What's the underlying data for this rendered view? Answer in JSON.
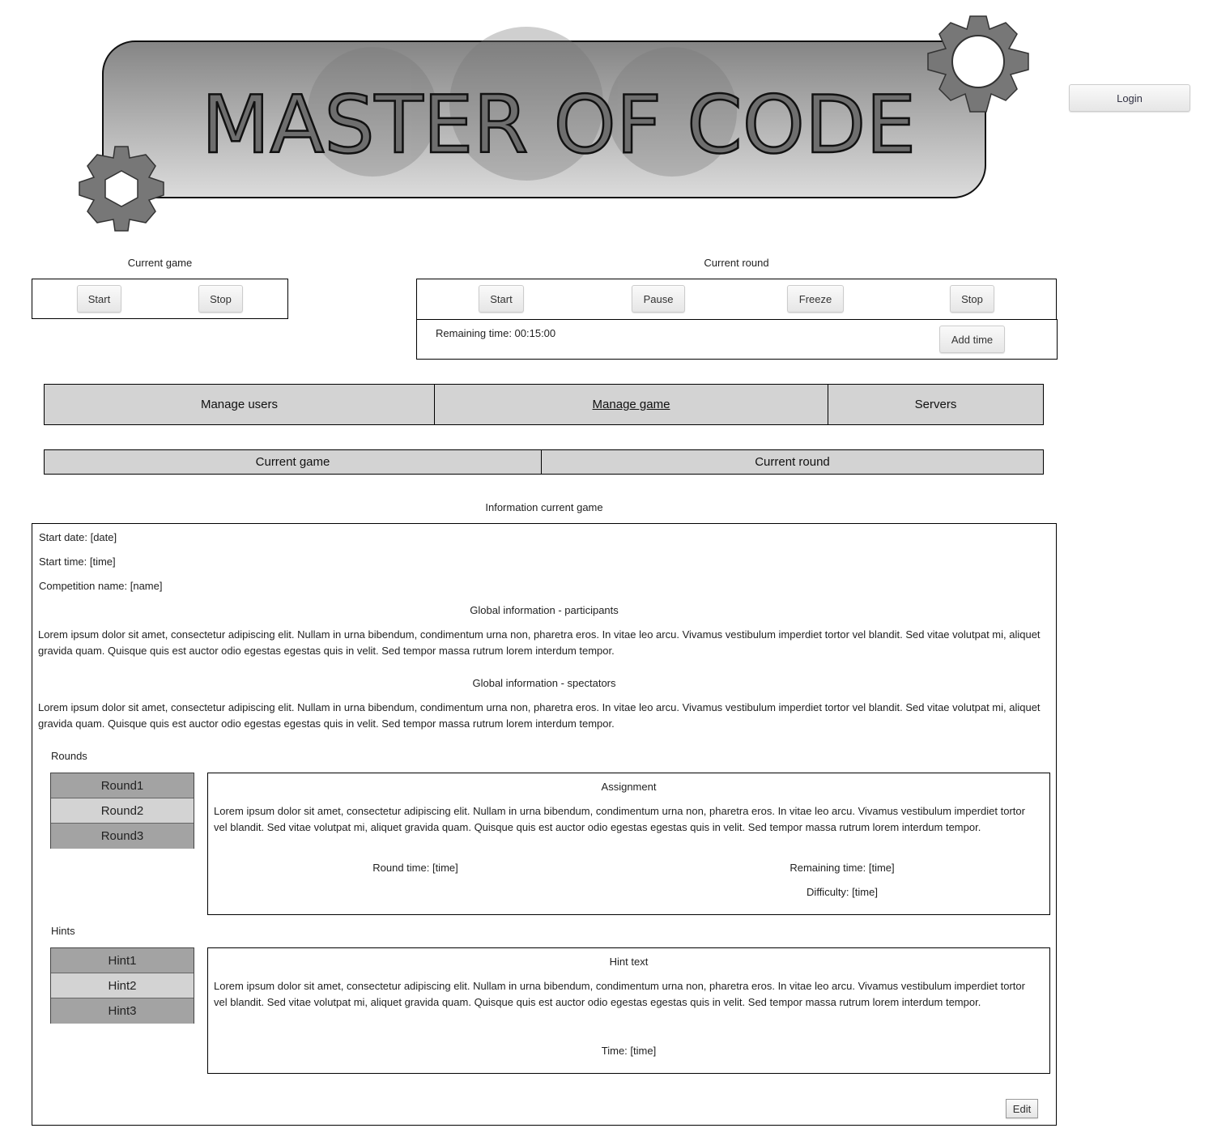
{
  "header": {
    "logo_text": "MASTER OF CODE",
    "login_label": "Login"
  },
  "current_game": {
    "title": "Current game",
    "start_label": "Start",
    "stop_label": "Stop"
  },
  "current_round": {
    "title": "Current round",
    "start_label": "Start",
    "pause_label": "Pause",
    "freeze_label": "Freeze",
    "stop_label": "Stop",
    "remaining_time": "Remaining time: 00:15:00",
    "add_time_label": "Add time"
  },
  "nav": {
    "tabs": [
      {
        "label": "Manage users"
      },
      {
        "label": "Manage game",
        "active": true
      },
      {
        "label": "Servers"
      }
    ]
  },
  "subnav": {
    "tabs": [
      {
        "label": "Current game"
      },
      {
        "label": "Current round"
      }
    ]
  },
  "info": {
    "title": "Information current game",
    "start_date": "Start date: [date]",
    "start_time": "Start time: [time]",
    "competition_name": "Competition name: [name]",
    "participants_heading": "Global information - participants",
    "participants_text": "Lorem ipsum dolor sit amet, consectetur adipiscing elit. Nullam in urna bibendum, condimentum urna non, pharetra eros. In vitae leo arcu. Vivamus vestibulum imperdiet tortor vel blandit. Sed vitae volutpat mi, aliquet gravida quam. Quisque quis est auctor odio egestas egestas quis in velit. Sed tempor massa rutrum lorem interdum tempor.",
    "spectators_heading": "Global information - spectators",
    "spectators_text": "Lorem ipsum dolor sit amet, consectetur adipiscing elit. Nullam in urna bibendum, condimentum urna non, pharetra eros. In vitae leo arcu. Vivamus vestibulum imperdiet tortor vel blandit. Sed vitae volutpat mi, aliquet gravida quam. Quisque quis est auctor odio egestas egestas quis in velit. Sed tempor massa rutrum lorem interdum tempor.",
    "rounds_label": "Rounds",
    "rounds": [
      "Round1",
      "Round2",
      "Round3"
    ],
    "assignment": {
      "heading": "Assignment",
      "text": "Lorem ipsum dolor sit amet, consectetur adipiscing elit. Nullam in urna bibendum, condimentum urna non, pharetra eros. In vitae leo arcu. Vivamus vestibulum imperdiet tortor vel blandit. Sed vitae volutpat mi, aliquet gravida quam. Quisque quis est auctor odio egestas egestas quis in velit. Sed tempor massa rutrum lorem interdum tempor.",
      "round_time": "Round time: [time]",
      "remaining_time": "Remaining time: [time]",
      "difficulty": "Difficulty: [time]"
    },
    "hints_label": "Hints",
    "hints": [
      "Hint1",
      "Hint2",
      "Hint3"
    ],
    "hint": {
      "heading": "Hint text",
      "text": "Lorem ipsum dolor sit amet, consectetur adipiscing elit. Nullam in urna bibendum, condimentum urna non, pharetra eros. In vitae leo arcu. Vivamus vestibulum imperdiet tortor vel blandit. Sed vitae volutpat mi, aliquet gravida quam. Quisque quis est auctor odio egestas egestas quis in velit. Sed tempor massa rutrum lorem interdum tempor.",
      "time": "Time: [time]"
    },
    "edit_label": "Edit"
  }
}
